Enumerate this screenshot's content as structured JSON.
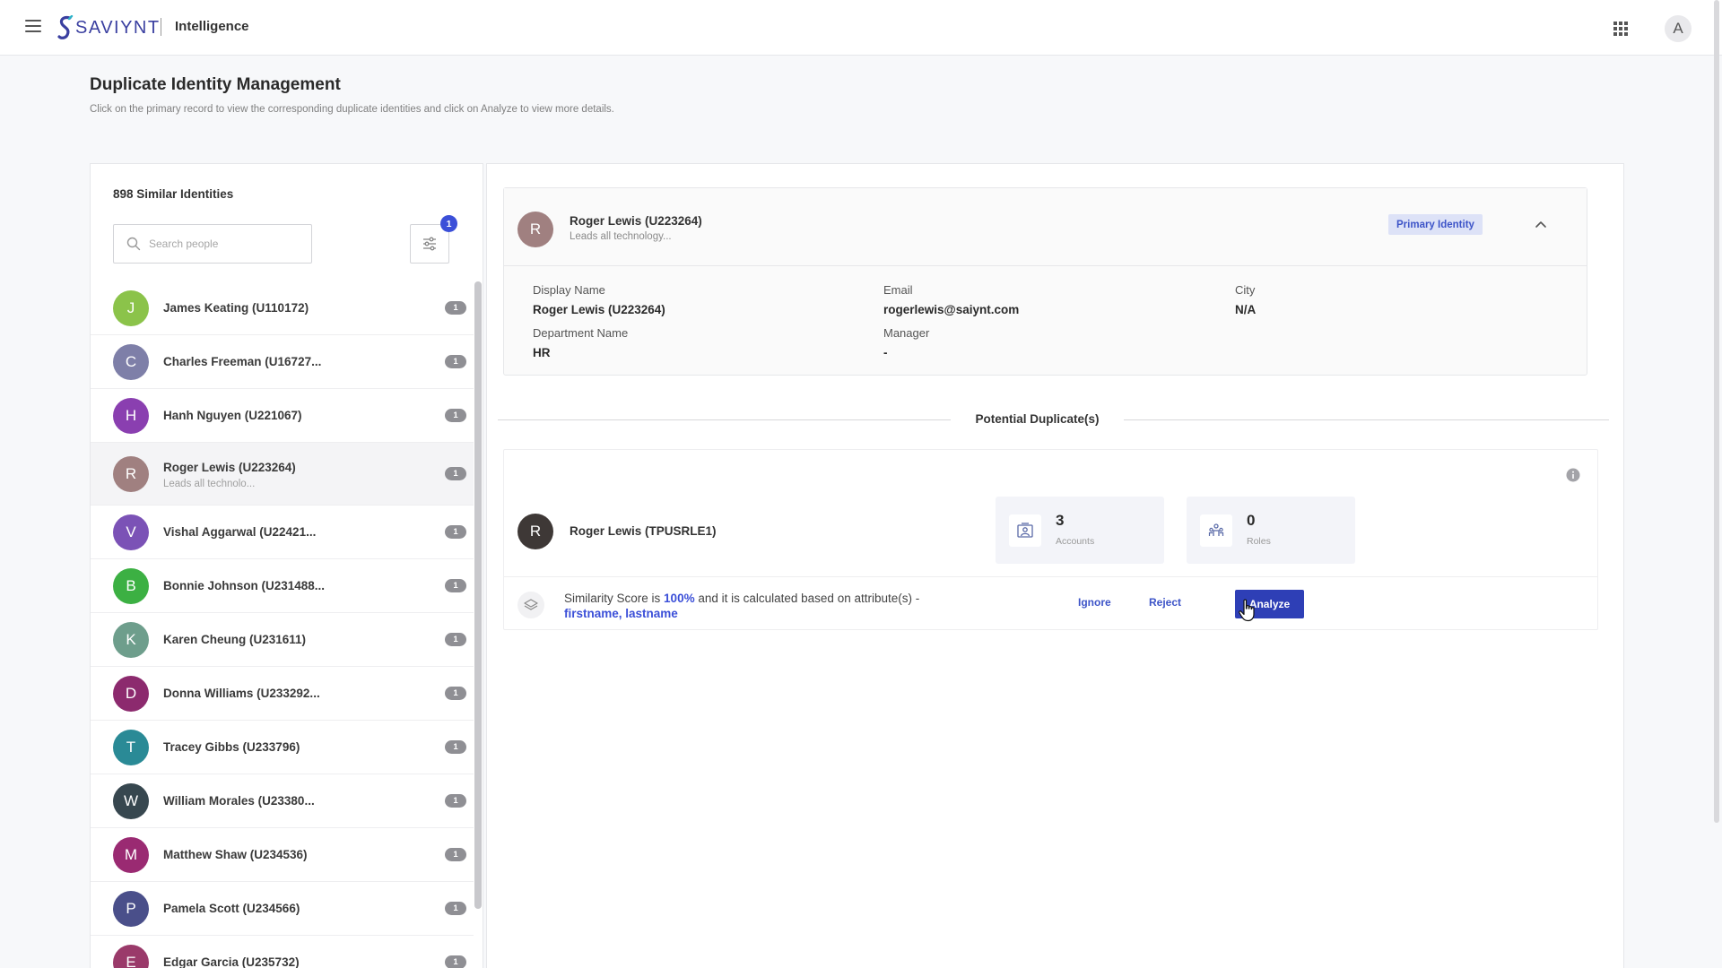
{
  "header": {
    "logo_text": "SAVIYNT",
    "app_name": "Intelligence",
    "user_initial": "A",
    "icons": [
      "hamburger-menu-icon",
      "apps-grid-icon"
    ]
  },
  "page": {
    "title": "Duplicate Identity Management",
    "subtitle": "Click on the primary record to view the corresponding duplicate identities and click on Analyze to view more details."
  },
  "left_panel": {
    "similar_count": "898 Similar Identities",
    "search_placeholder": "Search people",
    "filter_badge": "1",
    "people": [
      {
        "initial": "J",
        "name": "James Keating (U110172)",
        "sub": "",
        "count": "1",
        "color": "#8bc34a"
      },
      {
        "initial": "C",
        "name": "Charles Freeman (U16727...",
        "sub": "",
        "count": "1",
        "color": "#7e7fa8"
      },
      {
        "initial": "H",
        "name": "Hanh Nguyen (U221067)",
        "sub": "",
        "count": "1",
        "color": "#8a3fb0"
      },
      {
        "initial": "R",
        "name": "Roger Lewis (U223264)",
        "sub": "Leads all technolo...",
        "count": "1",
        "color": "#a08080"
      },
      {
        "initial": "V",
        "name": "Vishal Aggarwal (U22421...",
        "sub": "",
        "count": "1",
        "color": "#7b52b6"
      },
      {
        "initial": "B",
        "name": "Bonnie Johnson (U231488...",
        "sub": "",
        "count": "1",
        "color": "#3cb043"
      },
      {
        "initial": "K",
        "name": "Karen Cheung (U231611)",
        "sub": "",
        "count": "1",
        "color": "#6e9e8c"
      },
      {
        "initial": "D",
        "name": "Donna Williams (U233292...",
        "sub": "",
        "count": "1",
        "color": "#8c2a6e"
      },
      {
        "initial": "T",
        "name": "Tracey Gibbs (U233796)",
        "sub": "",
        "count": "1",
        "color": "#2a8a96"
      },
      {
        "initial": "W",
        "name": "William Morales (U23380...",
        "sub": "",
        "count": "1",
        "color": "#37474f"
      },
      {
        "initial": "M",
        "name": "Matthew Shaw (U234536)",
        "sub": "",
        "count": "1",
        "color": "#9a2a72"
      },
      {
        "initial": "P",
        "name": "Pamela Scott (U234566)",
        "sub": "",
        "count": "1",
        "color": "#4a4f8a"
      },
      {
        "initial": "E",
        "name": "Edgar Garcia (U235732)",
        "sub": "",
        "count": "1",
        "color": "#9a3a6a"
      }
    ]
  },
  "primary": {
    "initial": "R",
    "name": "Roger Lewis (U223264)",
    "description": "Leads all technology...",
    "badge": "Primary Identity",
    "attributes": {
      "display_name_label": "Display Name",
      "display_name_value": "Roger Lewis (U223264)",
      "email_label": "Email",
      "email_value": "rogerlewis@saiynt.com",
      "city_label": "City",
      "city_value": "N/A",
      "department_label": "Department Name",
      "department_value": "HR",
      "manager_label": "Manager",
      "manager_value": "-"
    }
  },
  "duplicates": {
    "section_title": "Potential Duplicate(s)",
    "item": {
      "initial": "R",
      "name": "Roger Lewis (TPUSRLE1)",
      "accounts_value": "3",
      "accounts_label": "Accounts",
      "roles_value": "0",
      "roles_label": "Roles",
      "score_prefix": "Similarity Score is",
      "score_value": "100%",
      "score_middle": "and it is calculated based on attribute(s) -",
      "score_attributes": "firstname, lastname",
      "ignore_label": "Ignore",
      "reject_label": "Reject",
      "analyze_label": "Analyze"
    }
  },
  "colors": {
    "accent": "#3b4fd8",
    "analyze_button": "#2e3fb6",
    "badge_bg": "#dde2f7",
    "count_pill": "#8f8f94"
  }
}
